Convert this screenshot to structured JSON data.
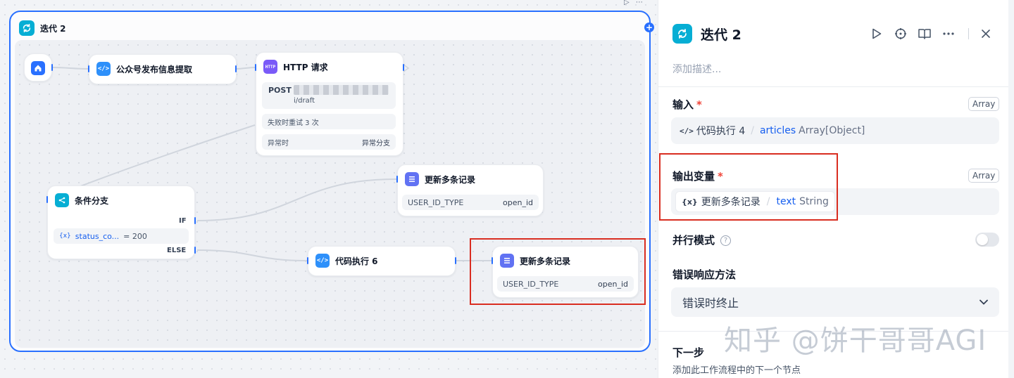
{
  "canvas": {
    "iteration_title": "迭代 2",
    "nodes": {
      "start": {},
      "extract": {
        "title": "公众号发布信息提取"
      },
      "http": {
        "title": "HTTP 请求",
        "icon_text": "HTTP",
        "method": "POST",
        "url_tail": "i/draft",
        "retry": "失败时重试 3 次",
        "error_label": "异常时",
        "error_value": "异常分支"
      },
      "update1": {
        "title": "更新多条记录",
        "key": "USER_ID_TYPE",
        "value": "open_id"
      },
      "condition": {
        "title": "条件分支",
        "if_label": "IF",
        "var_name": "status_co...",
        "expr": "= 200",
        "else_label": "ELSE"
      },
      "code6": {
        "title": "代码执行 6"
      },
      "update2": {
        "title": "更新多条记录",
        "key": "USER_ID_TYPE",
        "value": "open_id"
      }
    },
    "colors": {
      "accent": "#2970ff",
      "iteration_icon": "#06aed4",
      "highlight": "#d92d20"
    }
  },
  "panel": {
    "title": "迭代 2",
    "description_placeholder": "添加描述...",
    "input": {
      "label": "输入",
      "required": "*",
      "type_badge": "Array",
      "source_node": "代码执行 4",
      "var_name": "articles",
      "var_type": "Array[Object]"
    },
    "output": {
      "label": "输出变量",
      "required": "*",
      "type_badge": "Array",
      "source_node": "更新多条记录",
      "var_name": "text",
      "var_type": "String"
    },
    "parallel": {
      "label": "并行模式",
      "help": "?",
      "enabled": false
    },
    "error": {
      "label": "错误响应方法",
      "value": "错误时终止"
    },
    "next": {
      "label": "下一步",
      "description": "添加此工作流程中的下一个节点"
    },
    "watermark": "知乎 @饼干哥哥AGI"
  }
}
